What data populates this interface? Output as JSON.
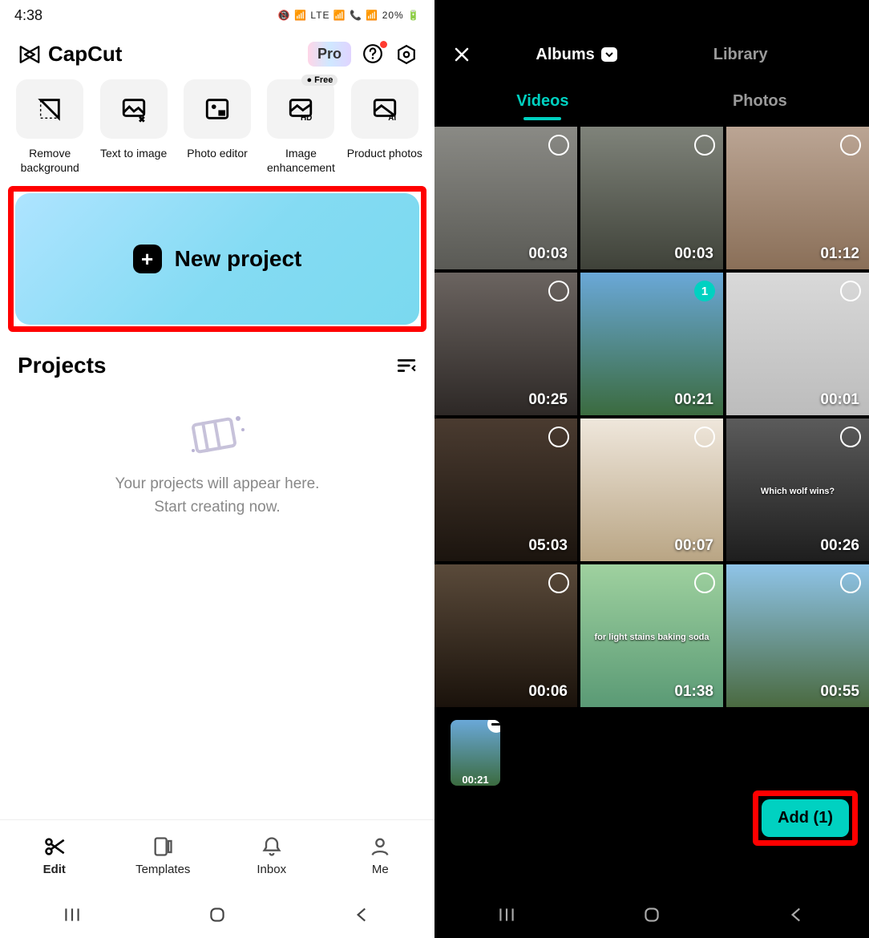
{
  "left": {
    "status": {
      "time": "4:38",
      "battery": "20%",
      "rhs_compact": "📵 📶 LTE 📶 📞 📶 20% 🔋"
    },
    "app": {
      "brand": "CapCut",
      "pro_label": "Pro",
      "tools": [
        {
          "label": "Remove background"
        },
        {
          "label": "Text to image"
        },
        {
          "label": "Photo editor"
        },
        {
          "label": "Image enhancement",
          "pill": "● Free"
        },
        {
          "label": "Product photos"
        }
      ],
      "new_project": "New project",
      "projects_heading": "Projects",
      "empty_line1": "Your projects will appear here.",
      "empty_line2": "Start creating now."
    },
    "nav": {
      "edit": "Edit",
      "templates": "Templates",
      "inbox": "Inbox",
      "me": "Me"
    }
  },
  "right": {
    "top_tabs": {
      "albums": "Albums",
      "library": "Library"
    },
    "media_tabs": {
      "videos": "Videos",
      "photos": "Photos"
    },
    "videos": [
      {
        "dur": "00:03"
      },
      {
        "dur": "00:03"
      },
      {
        "dur": "01:12"
      },
      {
        "dur": "00:25"
      },
      {
        "dur": "00:21",
        "selected_index": "1"
      },
      {
        "dur": "00:01"
      },
      {
        "dur": "05:03"
      },
      {
        "dur": "00:07"
      },
      {
        "dur": "00:26",
        "caption": "Which wolf wins?"
      },
      {
        "dur": "00:06"
      },
      {
        "dur": "01:38",
        "caption": "for light stains baking soda"
      },
      {
        "dur": "00:55"
      }
    ],
    "tray": {
      "items": [
        {
          "dur": "00:21"
        }
      ]
    },
    "add_button": "Add (1)"
  },
  "thumb_bgs": [
    "linear-gradient(#8a8a85,#5a5a55)",
    "linear-gradient(#7f837a,#3f4239)",
    "linear-gradient(#bba594,#8a6f58)",
    "linear-gradient(#6b6460,#2d2826)",
    "linear-gradient(#6aa8d8,#3b6b3f)",
    "linear-gradient(#d9d9d9,#bcbcbc)",
    "linear-gradient(#4a3b30,#1b140e)",
    "linear-gradient(#efe7dc,#b9a584)",
    "linear-gradient(#5b5b5b,#1e1e1e)",
    "linear-gradient(#5a4a3a,#1a120b)",
    "linear-gradient(#9fd19f,#5a9a75)",
    "linear-gradient(#8fc4e8,#4a6a40)"
  ]
}
